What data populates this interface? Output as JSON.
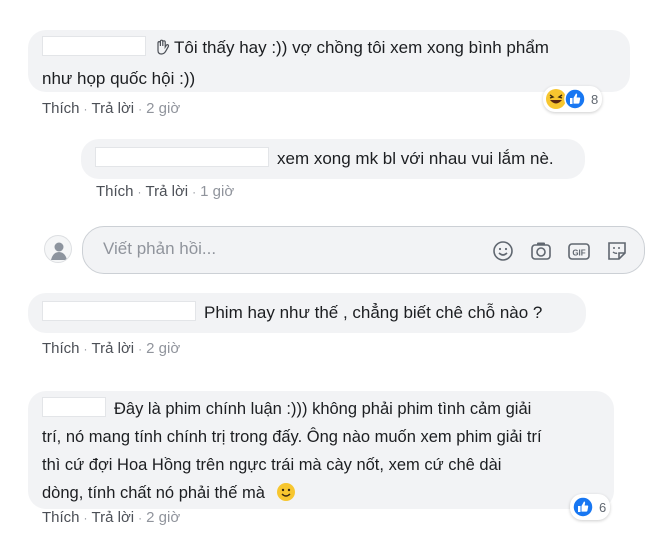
{
  "comment1": {
    "text_line1": "Tôi thấy hay   :)) vợ chồng tôi xem xong bình phẩm",
    "text_line2": "như họp quốc hội :))",
    "like": "Thích",
    "reply": "Trả lời",
    "time": "2 giờ",
    "reactions": {
      "count": "8",
      "icons": [
        "haha-icon",
        "like-icon"
      ]
    }
  },
  "reply1": {
    "text": "xem xong mk bl với nhau vui lắm nè.",
    "like": "Thích",
    "reply": "Trả lời",
    "time": "1 giờ"
  },
  "reply_input": {
    "placeholder": "Viết phản hồi..."
  },
  "comment2": {
    "text": "Phim hay như thế , chẳng biết chê chỗ nào ?",
    "like": "Thích",
    "reply": "Trả lời",
    "time": "2 giờ"
  },
  "comment3": {
    "text_line1": "Đây là phim chính luận :))) không phải phim tình cảm giải",
    "text_line2": "trí, nó mang tính chính trị trong đấy. Ông nào muốn xem phim giải trí",
    "text_line3": "thì cứ đợi Hoa Hồng trên ngực trái mà cày nốt, xem cứ chê dài",
    "text_line4": "dòng, tính chất nó phải thế mà",
    "like": "Thích",
    "reply": "Trả lời",
    "time": "2 giờ",
    "reactions": {
      "count": "6",
      "icons": [
        "like-icon"
      ]
    }
  },
  "colors": {
    "bubble": "#f2f3f5",
    "link": "#4b4f56",
    "like_blue": "#1877f2",
    "emoji_yellow": "#f7c62f"
  }
}
